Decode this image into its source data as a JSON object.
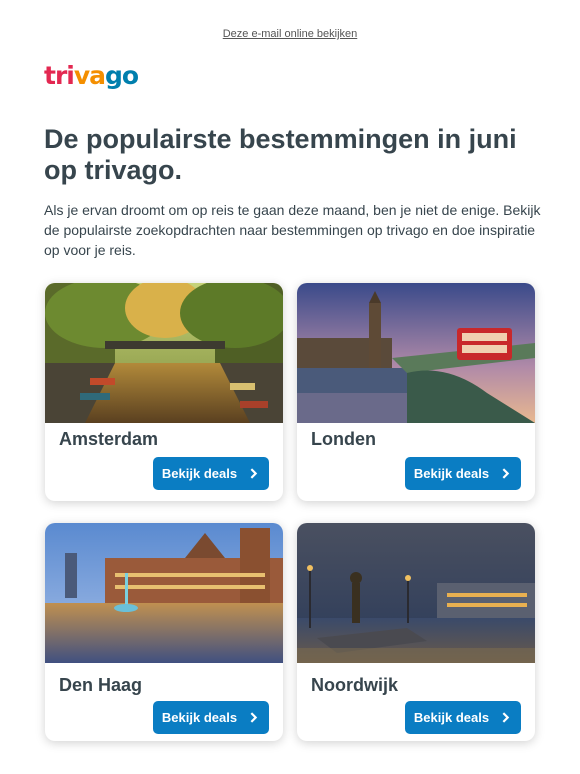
{
  "preheader": {
    "link": "Deze e-mail online bekijken"
  },
  "logo": {
    "part1": "tri",
    "part2": "va",
    "part3": "go"
  },
  "headline": "De populairste bestemmingen in juni op trivago.",
  "intro": "Als je ervan droomt om op reis te gaan deze maand, ben je niet de enige. Bekijk de populairste zoekopdrachten naar bestemmingen op trivago en doe inspiratie op voor je reis.",
  "destinations": [
    {
      "city": "Amsterdam",
      "button": "Bekijk deals"
    },
    {
      "city": "Londen",
      "button": "Bekijk deals"
    },
    {
      "city": "Den Haag",
      "button": "Bekijk deals"
    },
    {
      "city": "Noordwijk",
      "button": "Bekijk deals"
    }
  ],
  "colors": {
    "brand_red": "#e32851",
    "brand_orange": "#f48f00",
    "brand_blue": "#007fad",
    "button": "#0a7dc3",
    "text": "#37454d"
  }
}
